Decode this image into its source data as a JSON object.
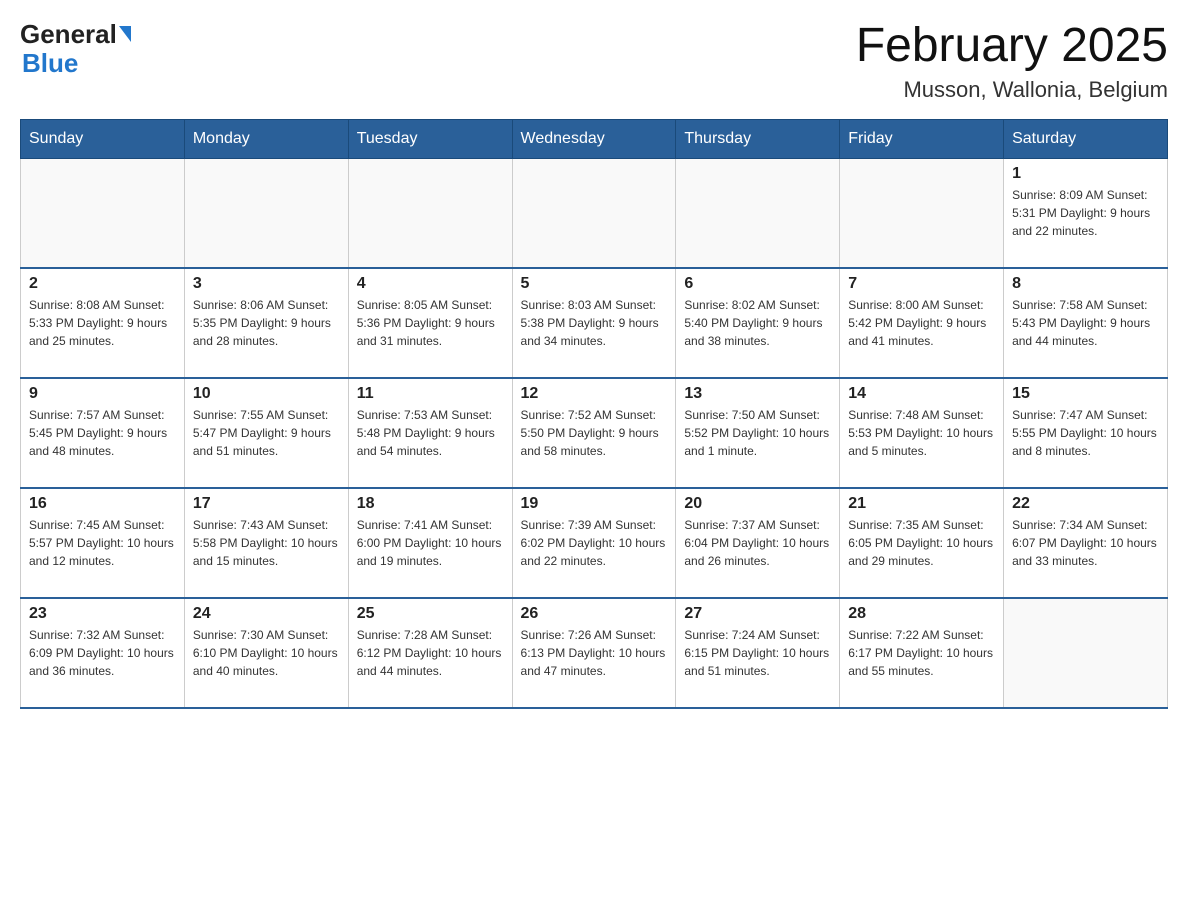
{
  "header": {
    "logo_text_general": "General",
    "logo_text_blue": "Blue",
    "title": "February 2025",
    "subtitle": "Musson, Wallonia, Belgium"
  },
  "weekdays": [
    "Sunday",
    "Monday",
    "Tuesday",
    "Wednesday",
    "Thursday",
    "Friday",
    "Saturday"
  ],
  "weeks": [
    [
      {
        "day": "",
        "info": ""
      },
      {
        "day": "",
        "info": ""
      },
      {
        "day": "",
        "info": ""
      },
      {
        "day": "",
        "info": ""
      },
      {
        "day": "",
        "info": ""
      },
      {
        "day": "",
        "info": ""
      },
      {
        "day": "1",
        "info": "Sunrise: 8:09 AM\nSunset: 5:31 PM\nDaylight: 9 hours and 22 minutes."
      }
    ],
    [
      {
        "day": "2",
        "info": "Sunrise: 8:08 AM\nSunset: 5:33 PM\nDaylight: 9 hours and 25 minutes."
      },
      {
        "day": "3",
        "info": "Sunrise: 8:06 AM\nSunset: 5:35 PM\nDaylight: 9 hours and 28 minutes."
      },
      {
        "day": "4",
        "info": "Sunrise: 8:05 AM\nSunset: 5:36 PM\nDaylight: 9 hours and 31 minutes."
      },
      {
        "day": "5",
        "info": "Sunrise: 8:03 AM\nSunset: 5:38 PM\nDaylight: 9 hours and 34 minutes."
      },
      {
        "day": "6",
        "info": "Sunrise: 8:02 AM\nSunset: 5:40 PM\nDaylight: 9 hours and 38 minutes."
      },
      {
        "day": "7",
        "info": "Sunrise: 8:00 AM\nSunset: 5:42 PM\nDaylight: 9 hours and 41 minutes."
      },
      {
        "day": "8",
        "info": "Sunrise: 7:58 AM\nSunset: 5:43 PM\nDaylight: 9 hours and 44 minutes."
      }
    ],
    [
      {
        "day": "9",
        "info": "Sunrise: 7:57 AM\nSunset: 5:45 PM\nDaylight: 9 hours and 48 minutes."
      },
      {
        "day": "10",
        "info": "Sunrise: 7:55 AM\nSunset: 5:47 PM\nDaylight: 9 hours and 51 minutes."
      },
      {
        "day": "11",
        "info": "Sunrise: 7:53 AM\nSunset: 5:48 PM\nDaylight: 9 hours and 54 minutes."
      },
      {
        "day": "12",
        "info": "Sunrise: 7:52 AM\nSunset: 5:50 PM\nDaylight: 9 hours and 58 minutes."
      },
      {
        "day": "13",
        "info": "Sunrise: 7:50 AM\nSunset: 5:52 PM\nDaylight: 10 hours and 1 minute."
      },
      {
        "day": "14",
        "info": "Sunrise: 7:48 AM\nSunset: 5:53 PM\nDaylight: 10 hours and 5 minutes."
      },
      {
        "day": "15",
        "info": "Sunrise: 7:47 AM\nSunset: 5:55 PM\nDaylight: 10 hours and 8 minutes."
      }
    ],
    [
      {
        "day": "16",
        "info": "Sunrise: 7:45 AM\nSunset: 5:57 PM\nDaylight: 10 hours and 12 minutes."
      },
      {
        "day": "17",
        "info": "Sunrise: 7:43 AM\nSunset: 5:58 PM\nDaylight: 10 hours and 15 minutes."
      },
      {
        "day": "18",
        "info": "Sunrise: 7:41 AM\nSunset: 6:00 PM\nDaylight: 10 hours and 19 minutes."
      },
      {
        "day": "19",
        "info": "Sunrise: 7:39 AM\nSunset: 6:02 PM\nDaylight: 10 hours and 22 minutes."
      },
      {
        "day": "20",
        "info": "Sunrise: 7:37 AM\nSunset: 6:04 PM\nDaylight: 10 hours and 26 minutes."
      },
      {
        "day": "21",
        "info": "Sunrise: 7:35 AM\nSunset: 6:05 PM\nDaylight: 10 hours and 29 minutes."
      },
      {
        "day": "22",
        "info": "Sunrise: 7:34 AM\nSunset: 6:07 PM\nDaylight: 10 hours and 33 minutes."
      }
    ],
    [
      {
        "day": "23",
        "info": "Sunrise: 7:32 AM\nSunset: 6:09 PM\nDaylight: 10 hours and 36 minutes."
      },
      {
        "day": "24",
        "info": "Sunrise: 7:30 AM\nSunset: 6:10 PM\nDaylight: 10 hours and 40 minutes."
      },
      {
        "day": "25",
        "info": "Sunrise: 7:28 AM\nSunset: 6:12 PM\nDaylight: 10 hours and 44 minutes."
      },
      {
        "day": "26",
        "info": "Sunrise: 7:26 AM\nSunset: 6:13 PM\nDaylight: 10 hours and 47 minutes."
      },
      {
        "day": "27",
        "info": "Sunrise: 7:24 AM\nSunset: 6:15 PM\nDaylight: 10 hours and 51 minutes."
      },
      {
        "day": "28",
        "info": "Sunrise: 7:22 AM\nSunset: 6:17 PM\nDaylight: 10 hours and 55 minutes."
      },
      {
        "day": "",
        "info": ""
      }
    ]
  ]
}
